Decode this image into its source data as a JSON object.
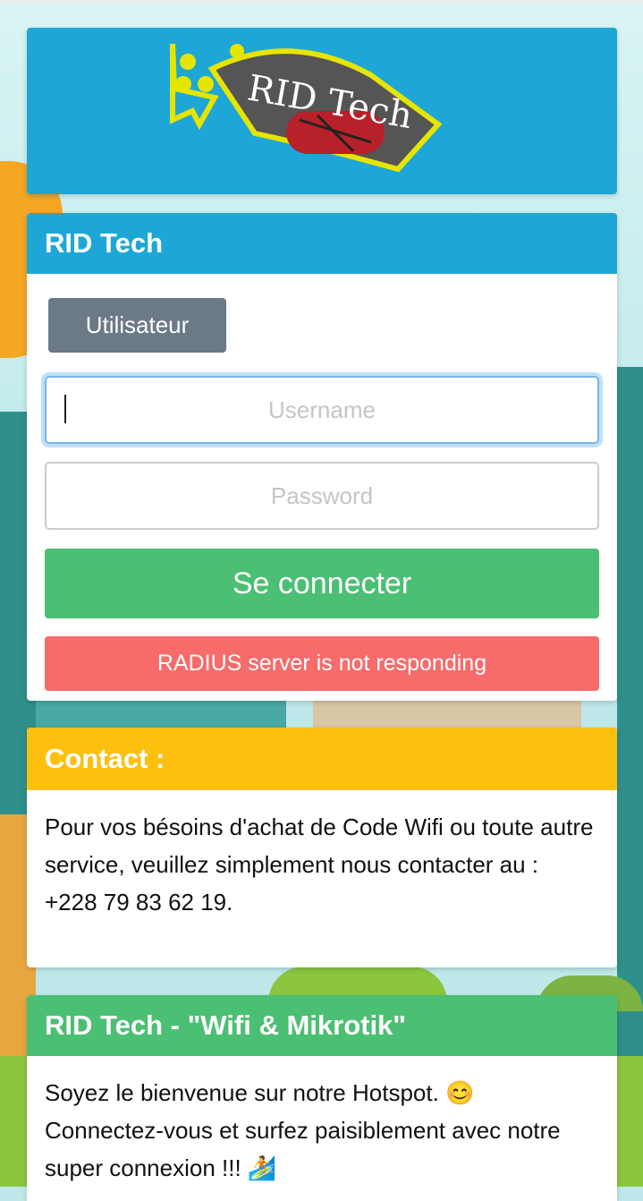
{
  "logo": {
    "text": "RID Tech"
  },
  "login_panel": {
    "title": "RID Tech",
    "user_tab_label": "Utilisateur",
    "username_placeholder": "Username",
    "password_placeholder": "Password",
    "login_button_label": "Se connecter",
    "error_message": "RADIUS server is not responding"
  },
  "contact_panel": {
    "title": "Contact :",
    "line1": "Pour vos bésoins d'achat de Code Wifi ou toute autre service, veuillez simplement nous contacter au :",
    "phone": "+228 79 83 62 19."
  },
  "welcome_panel": {
    "title": "RID Tech - \"Wifi & Mikrotik\"",
    "line1": "Soyez le bienvenue sur notre Hotspot. 😊",
    "line2": "Connectez-vous et surfez paisiblement avec notre super connexion !!! 🏄"
  },
  "colors": {
    "blue_header": "#1ea7d6",
    "contact_header": "#fdc00f",
    "welcome_header": "#4bbf73",
    "login_button": "#4bbf73",
    "error": "#f76b6b",
    "user_tab": "#6c7a87"
  },
  "icons": {
    "logo": "rid-tech-logo-icon"
  }
}
